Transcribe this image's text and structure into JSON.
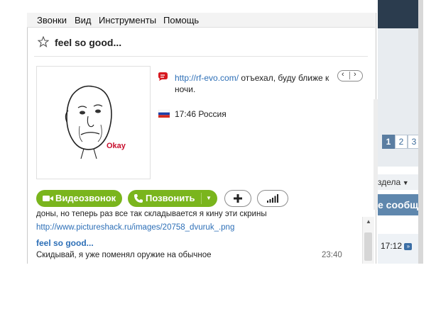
{
  "menu": [
    "Звонки",
    "Вид",
    "Инструменты",
    "Помощь"
  ],
  "contact": {
    "name": "feel so good...",
    "mood_link": "http://rf-evo.com/",
    "mood_text": " отъехал, буду ближе к ночи.",
    "local_time": "17:46 Россия",
    "avatar_label": "Okay"
  },
  "buttons": {
    "video": "Видеозвонок",
    "call": "Позвонить"
  },
  "chat": {
    "partial_line": "доны, но теперь раз все так складывается я кину эти скрины",
    "link": "http://www.pictureshack.ru/images/20758_dvuruk_.png",
    "sender": "feel so good...",
    "message": "Скидывай, я уже поменял оружие на обычное",
    "time": "23:40"
  },
  "background_page": {
    "pages": [
      "1",
      "2",
      "3"
    ],
    "sort_label": "здела",
    "banner": "е сообще",
    "row_time": "17:12"
  },
  "colors": {
    "accent_green": "#7ab51d",
    "link_blue": "#2d6fb7",
    "forum_header": "#2b3c4e"
  }
}
